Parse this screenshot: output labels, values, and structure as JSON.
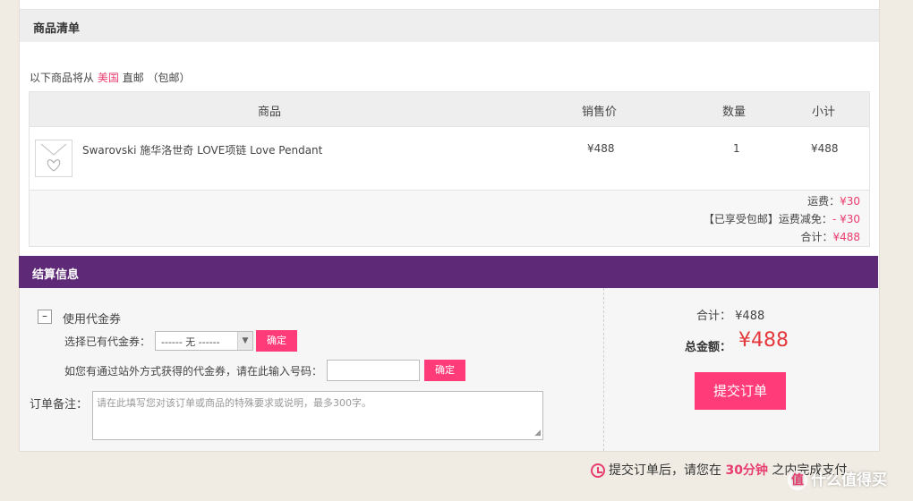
{
  "goods_section": {
    "title": "商品清单",
    "ship_prefix": "以下商品将从",
    "ship_country": "美国",
    "ship_mode": "直邮",
    "ship_tag": "（包邮）"
  },
  "table": {
    "headers": {
      "product": "商品",
      "price": "销售价",
      "qty": "数量",
      "subtotal": "小计"
    },
    "rows": [
      {
        "name": "Swarovski 施华洛世奇 LOVE项链 Love Pendant",
        "price": "¥488",
        "qty": "1",
        "subtotal": "¥488",
        "thumb_icon": "heart-pendant-icon"
      }
    ],
    "summary": {
      "shipping_label": "运费：",
      "shipping_value": "¥30",
      "discount_label": "【已享受包邮】运费减免：",
      "discount_value": "- ¥30",
      "total_label": "合计：",
      "total_value": "¥488"
    }
  },
  "checkout": {
    "title": "结算信息",
    "coupon_toggle": "–",
    "coupon_title": "使用代金券",
    "existing_label": "选择已有代金券：",
    "existing_select": "------ 无 ------",
    "confirm_label": "确定",
    "code_label": "如您有通过站外方式获得的代金券，请在此输入号码：",
    "code_value": "",
    "confirm_label_2": "确定",
    "remark_label": "订单备注：",
    "remark_placeholder": "请在此填写您对该订单或商品的特殊要求或说明，最多300字。",
    "sum_label": "合计：",
    "sum_value": "¥488",
    "grand_label": "总金额：",
    "grand_value": "¥488",
    "submit_label": "提交订单"
  },
  "footer": {
    "note_prefix": "提交订单后，请您在",
    "note_highlight": "30分钟",
    "note_suffix": "之内完成支付",
    "clock_icon": "clock-icon"
  },
  "watermark": {
    "text": "什么值得买",
    "logo_glyph": "值"
  },
  "colors": {
    "accent": "#ff3b7a",
    "header_purple": "#5e2a77",
    "price_red": "#e4393c"
  }
}
